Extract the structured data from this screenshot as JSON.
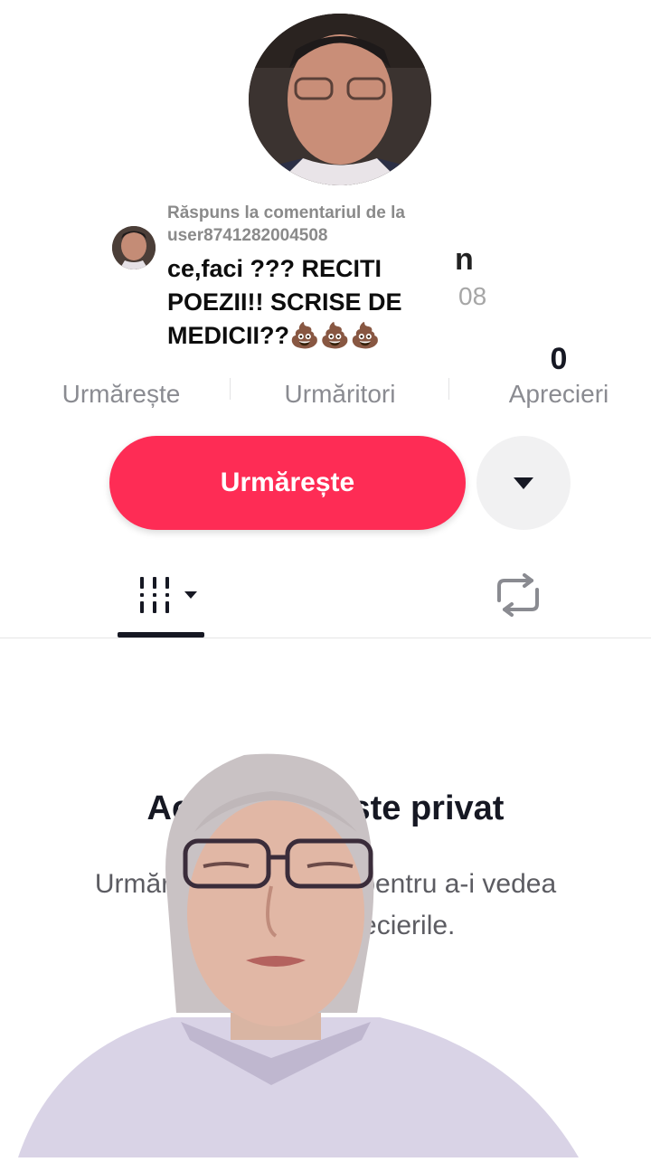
{
  "reply": {
    "header": "Răspuns la comentariul de la user8741282004508",
    "text": "ce,faci ??? RECITI POEZII!! SCRISE DE MEDICII??💩💩💩"
  },
  "profile": {
    "name_fragment": "n",
    "username_fragment": "08"
  },
  "stats": [
    {
      "value": "",
      "label": "Urmărește"
    },
    {
      "value": "",
      "label": "Urmăritori"
    },
    {
      "value": "0",
      "label": "Aprecieri"
    }
  ],
  "actions": {
    "follow_label": "Urmărește"
  },
  "private_notice": {
    "title": "Acest cont este privat",
    "description": "Urmărește acest cont pentru a-i vedea clipurile și aprecierile."
  },
  "colors": {
    "accent": "#fe2c55",
    "text": "#161823",
    "muted": "#8a8b91"
  }
}
